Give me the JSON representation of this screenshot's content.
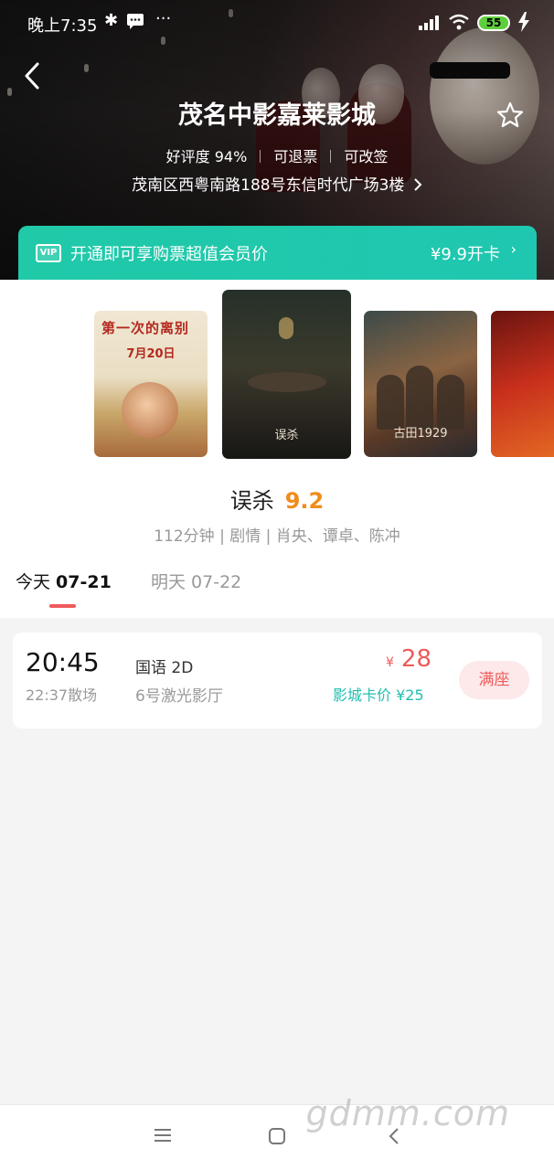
{
  "status_bar": {
    "time": "晚上7:35",
    "more": "···",
    "battery": "55"
  },
  "cinema": {
    "name": "茂名中影嘉莱影城",
    "rating": "好评度 94%",
    "refundable": "可退票",
    "changeable": "可改签",
    "address": "茂南区西粤南路188号东信时代广场3楼"
  },
  "vip": {
    "badge": "VIP",
    "text": "开通即可享购票超值会员价",
    "price": "¥9.9开卡"
  },
  "posters": {
    "p1_title": "第一次的离别",
    "p1_date": "7月20日",
    "p2_text": "误杀",
    "p3_text": "古田1929"
  },
  "movie": {
    "title": "误杀",
    "score": "9.2",
    "meta": "112分钟 | 剧情 | 肖央、谭卓、陈冲"
  },
  "tabs": {
    "today_prefix": "今天 ",
    "today_date": "07-21",
    "tomorrow": "明天 07-22"
  },
  "showtime": {
    "start": "20:45",
    "end": "22:37散场",
    "language": "国语 2D",
    "hall": "6号激光影厅",
    "currency": "¥",
    "price": "28",
    "card_price": "影城卡价 ¥25",
    "status": "满座"
  },
  "watermark": "gdmm.com",
  "colors": {
    "accent_red": "#ef5a5a",
    "score_orange": "#f08c1c",
    "vip_teal": "#20c9a8",
    "card_teal": "#20bfb0"
  }
}
